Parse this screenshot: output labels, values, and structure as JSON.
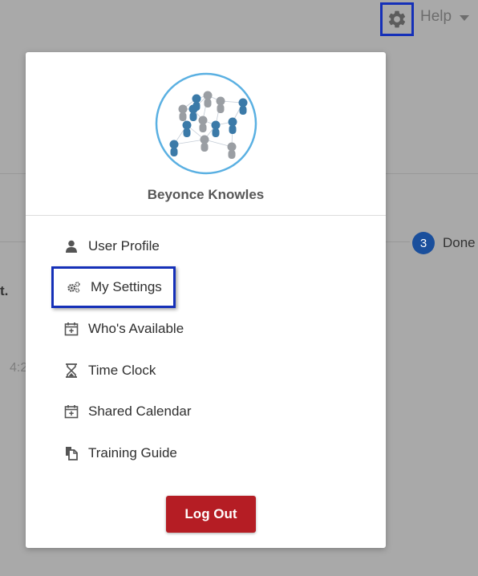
{
  "header": {
    "help_label": "Help"
  },
  "background": {
    "step_number": "3",
    "step_label": "Done",
    "partial_text": "t.",
    "partial_time": "4:2"
  },
  "profile": {
    "user_name": "Beyonce Knowles"
  },
  "menu": {
    "items": [
      {
        "label": "User Profile",
        "icon": "user-icon"
      },
      {
        "label": "My Settings",
        "icon": "cogs-icon"
      },
      {
        "label": "Who's Available",
        "icon": "calendar-plus-icon"
      },
      {
        "label": "Time Clock",
        "icon": "hourglass-icon"
      },
      {
        "label": "Shared Calendar",
        "icon": "calendar-plus-icon"
      },
      {
        "label": "Training Guide",
        "icon": "copy-icon"
      }
    ]
  },
  "logout": {
    "label": "Log Out"
  },
  "colors": {
    "highlight": "#1530b8",
    "logout": "#b51d24",
    "step": "#1a4f9c",
    "avatar_ring": "#5ab0e2"
  }
}
